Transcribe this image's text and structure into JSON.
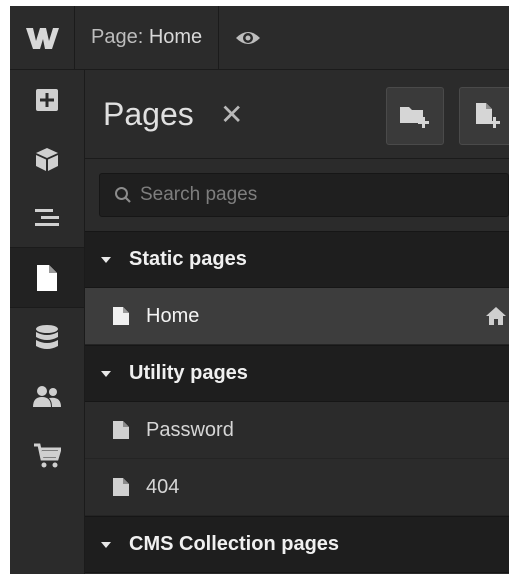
{
  "topbar": {
    "logo_text": "W",
    "page_prefix": "Page:",
    "page_name": "Home"
  },
  "rail": {
    "items": [
      {
        "name": "add-panel",
        "icon": "plus-square-icon"
      },
      {
        "name": "components",
        "icon": "cube-icon"
      },
      {
        "name": "navigator",
        "icon": "layers-lines-icon"
      },
      {
        "name": "pages",
        "icon": "page-icon",
        "active": true
      },
      {
        "name": "cms",
        "icon": "database-icon"
      },
      {
        "name": "users",
        "icon": "users-icon"
      },
      {
        "name": "ecommerce",
        "icon": "cart-icon"
      }
    ]
  },
  "panel": {
    "title": "Pages",
    "close_symbol": "✕",
    "search_placeholder": "Search pages",
    "sections": [
      {
        "label": "Static pages",
        "pages": [
          {
            "name": "Home",
            "selected": true,
            "home": true
          }
        ]
      },
      {
        "label": "Utility pages",
        "pages": [
          {
            "name": "Password"
          },
          {
            "name": "404"
          }
        ]
      },
      {
        "label": "CMS Collection pages",
        "pages": []
      }
    ]
  },
  "colors": {
    "background": "#2b2b2b",
    "section_header": "#1e1e1e",
    "selected_row": "#3d3d3d",
    "text": "#d6d6d6"
  }
}
